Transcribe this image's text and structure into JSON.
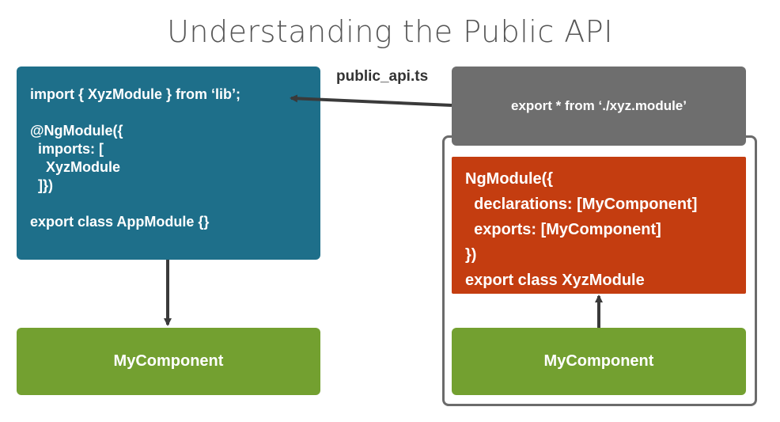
{
  "title": "Understanding the Public API",
  "file_label": "public_api.ts",
  "app_module": {
    "lines": [
      "import { XyzModule } from ‘lib’;",
      "",
      "@NgModule({",
      "  imports: [",
      "    XyzModule",
      "  ]})",
      "",
      "export class AppModule {}"
    ]
  },
  "public_api_export": "export * from ‘./xyz.module’",
  "xyz_module": {
    "lines": [
      "NgModule({",
      "  declarations: [MyComponent]",
      "  exports: [MyComponent]",
      "})",
      "export class XyzModule"
    ]
  },
  "components": {
    "left": "MyComponent",
    "right": "MyComponent"
  },
  "colors": {
    "app_module": "#1e6f8a",
    "xyz_module": "#c43d10",
    "component": "#73a030",
    "public_api": "#6e6e6e",
    "arrow": "#3a3a3a"
  }
}
